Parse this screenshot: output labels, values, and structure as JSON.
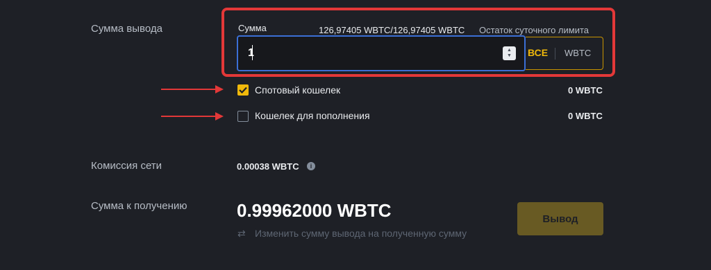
{
  "amount_section": {
    "label": "Сумма вывода",
    "field_label": "Сумма",
    "available": "126,97405 WBTC/126,97405 WBTC",
    "limit_label": "Остаток суточного лимита",
    "input_value": "1",
    "max_label": "ВСЕ",
    "unit": "WBTC"
  },
  "wallets": [
    {
      "label": "Спотовый кошелек",
      "checked": true,
      "balance": "0 WBTC"
    },
    {
      "label": "Кошелек для пополнения",
      "checked": false,
      "balance": "0 WBTC"
    }
  ],
  "fee": {
    "label": "Комиссия сети",
    "value": "0.00038 WBTC",
    "icon": "info-icon"
  },
  "receive": {
    "label": "Сумма к получению",
    "value": "0.99962000 WBTC",
    "switch_text": "Изменить сумму вывода на полученную сумму",
    "switch_icon": "swap-icon"
  },
  "withdraw_button": "Вывод",
  "colors": {
    "accent": "#f0b90b",
    "annotation": "#e33838",
    "focus": "#3b6fd6",
    "background": "#1e2026"
  }
}
